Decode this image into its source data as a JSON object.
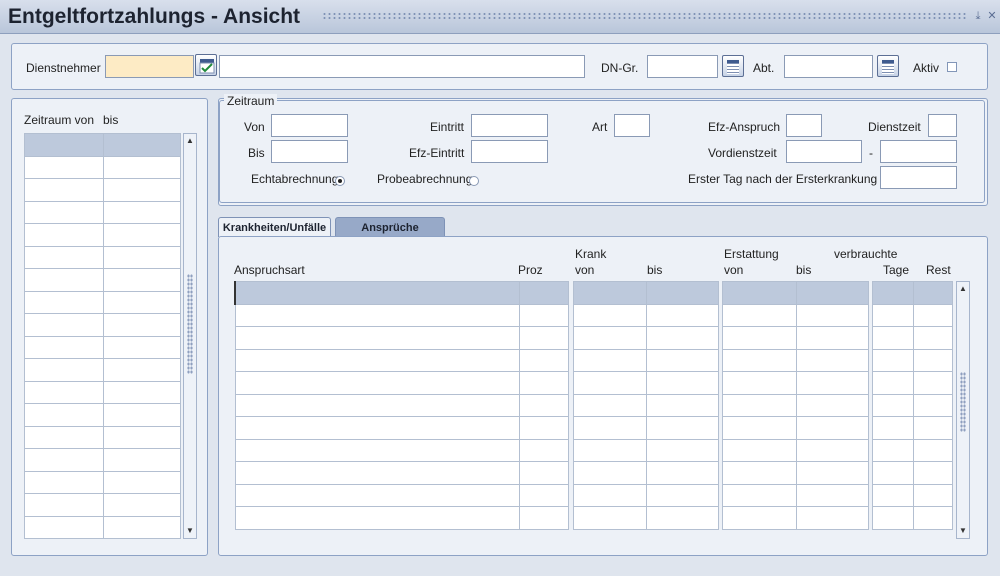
{
  "window": {
    "title": "Entgeltfortzahlungs - Ansicht",
    "min_btn": "⤓",
    "close_btn": "✕"
  },
  "header": {
    "employee_label": "Dienstnehmer",
    "dn_group_label": "DN-Gr.",
    "dept_label": "Abt.",
    "active_label": "Aktiv"
  },
  "left_list": {
    "col_from": "Zeitraum von",
    "col_to": "bis"
  },
  "period": {
    "legend": "Zeitraum",
    "von": "Von",
    "bis": "Bis",
    "eintritt": "Eintritt",
    "efz_eintritt": "Efz-Eintritt",
    "art": "Art",
    "efz_anspruch": "Efz-Anspruch",
    "dienstzeit": "Dienstzeit",
    "vordienstzeit": "Vordienstzeit",
    "dash": "-",
    "erster_tag": "Erster Tag nach der Ersterkrankung",
    "echtabrechnung": "Echtabrechnung",
    "probeabrechnung": "Probeabrechnung"
  },
  "tabs": [
    {
      "label": "Krankheiten/Unfälle"
    },
    {
      "label": "Ansprüche"
    }
  ],
  "claims_table": {
    "anspruchsart": "Anspruchsart",
    "proz": "Proz",
    "krank": "Krank",
    "krank_von": "von",
    "krank_bis": "bis",
    "erstattung": "Erstattung",
    "erst_von": "von",
    "erst_bis": "bis",
    "verbrauchte": "verbrauchte",
    "tage": "Tage",
    "rest": "Rest"
  },
  "scroll": {
    "up": "▲",
    "down": "▼"
  }
}
